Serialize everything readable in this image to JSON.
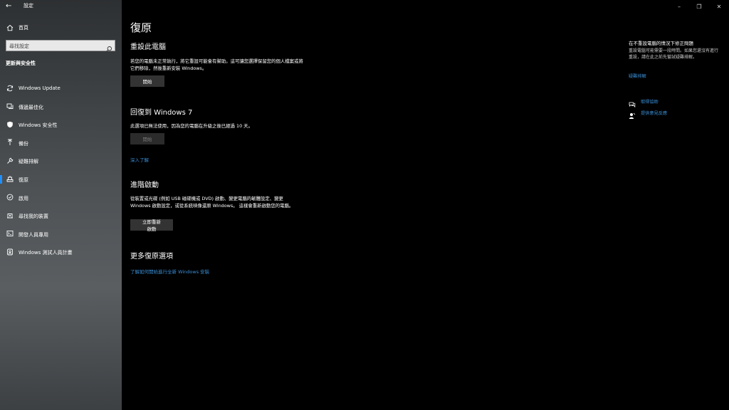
{
  "window": {
    "title": "設定",
    "controls": {
      "minimize": "–",
      "restore": "❐",
      "close": "✕"
    }
  },
  "sidebar": {
    "home_label": "首頁",
    "search_placeholder": "尋找設定",
    "section_heading": "更新與安全性",
    "items": [
      {
        "label": "Windows Update",
        "icon": "sync-icon"
      },
      {
        "label": "傳遞最佳化",
        "icon": "delivery-optimization-icon"
      },
      {
        "label": "Windows 安全性",
        "icon": "shield-icon"
      },
      {
        "label": "備份",
        "icon": "backup-icon"
      },
      {
        "label": "疑難排解",
        "icon": "wrench-icon"
      },
      {
        "label": "復原",
        "icon": "recovery-icon",
        "selected": true
      },
      {
        "label": "啟用",
        "icon": "activation-icon"
      },
      {
        "label": "尋找我的裝置",
        "icon": "find-device-icon"
      },
      {
        "label": "開發人員專用",
        "icon": "developer-icon"
      },
      {
        "label": "Windows 測試人員計畫",
        "icon": "insider-icon"
      }
    ]
  },
  "main": {
    "title": "復原",
    "reset": {
      "heading": "重設此電腦",
      "description": "若您的電腦未正常執行，將它重設可能會有幫助。這可讓您選擇保留您的個人檔案或將它們移除，然後重新安裝 Windows。",
      "button": "開始"
    },
    "goback": {
      "heading": "回復到 Windows 7",
      "description": "此選項已無法使用，因為您的電腦在升級之後已經過 10 天。",
      "button": "開始",
      "link": "深入了解"
    },
    "advanced": {
      "heading": "進階啟動",
      "description": "從裝置或光碟 (例如 USB 磁碟機或 DVD) 啟動、變更電腦的韌體設定、變更 Windows 啟動設定，或從系統映像還原 Windows。 這樣會重新啟動您的電腦。",
      "button": "立即重新啟動"
    },
    "more": {
      "heading": "更多復原選項",
      "link": "了解如何開始進行全新 Windows 安裝"
    }
  },
  "right_panel": {
    "title": "在不重設電腦的情況下修正問題",
    "text": "重設電腦可能需要一段時間。如果您還沒有進行重設，請在此之前先嘗試疑難排解。",
    "troubleshoot_link": "疑難排解",
    "help_link": "取得協助",
    "feedback_link": "提供意見反應"
  },
  "colors": {
    "accent": "#1e90ff",
    "link": "#3a8fd8",
    "background": "#000000"
  }
}
